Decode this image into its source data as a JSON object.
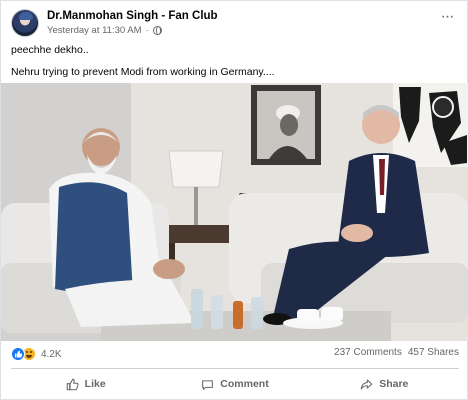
{
  "post": {
    "page_name": "Dr.Manmohan Singh - Fan Club",
    "timestamp": "Yesterday at 11:30 AM",
    "separator": "·",
    "privacy_icon": "globe-icon",
    "more_icon": "more-options-icon",
    "text_lines": [
      "peechhe dekho..",
      "Nehru trying to prevent Modi from working in Germany...."
    ]
  },
  "stats": {
    "reaction_icons": [
      "like-icon",
      "haha-icon"
    ],
    "reaction_count": "4.2K",
    "comments": "237 Comments",
    "shares": "457 Shares"
  },
  "actions": {
    "like_label": "Like",
    "comment_label": "Comment",
    "share_label": "Share"
  },
  "colors": {
    "like_blue": "#1877f2",
    "haha_yellow": "#f7b125",
    "meta_gray": "#65676b"
  }
}
